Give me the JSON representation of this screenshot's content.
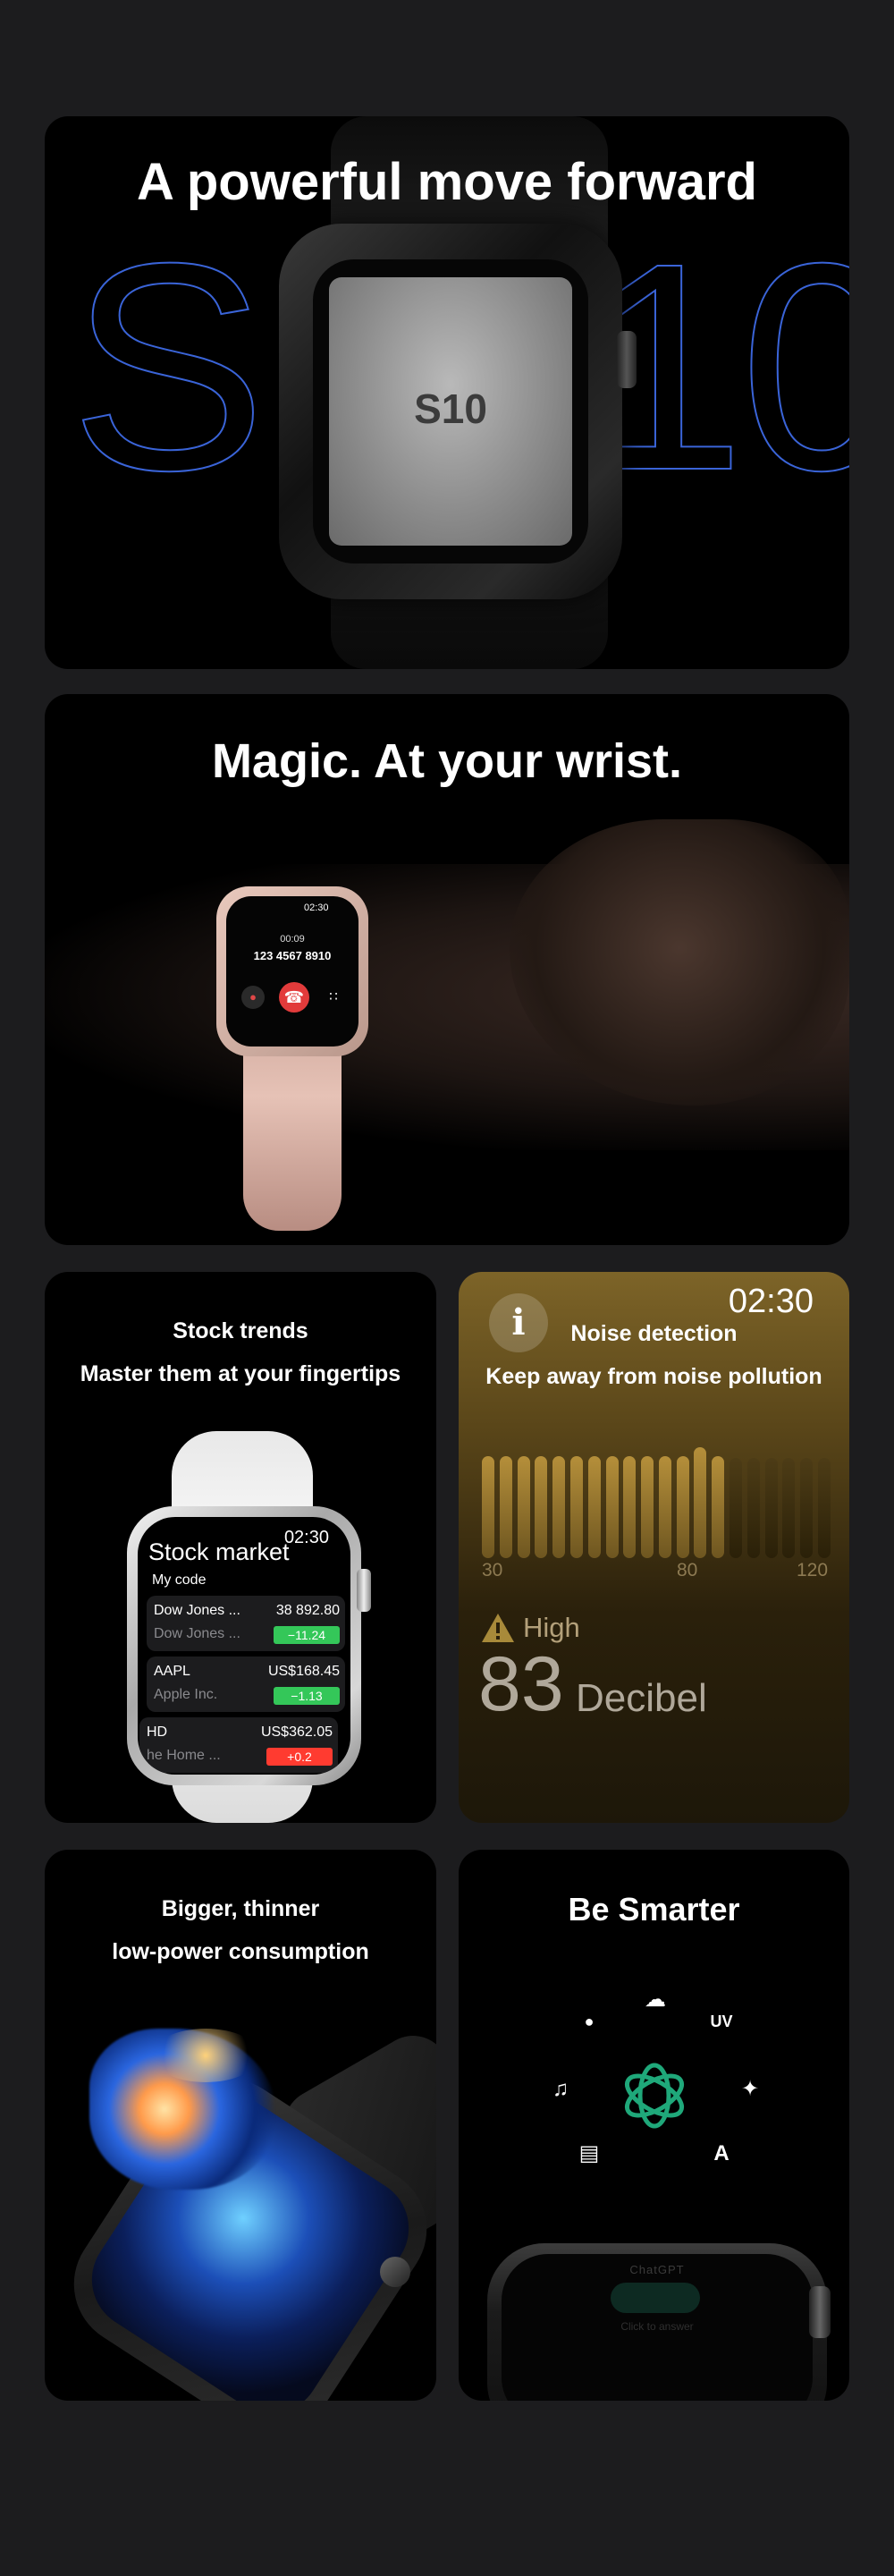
{
  "hero": {
    "title": "A powerful move forward",
    "outline_left": "S",
    "outline_right": "10",
    "chip_label": "S10"
  },
  "wrist": {
    "title": "Magic. At your wrist.",
    "call_time": "02:30",
    "call_duration": "00:09",
    "call_number": "123 4567 8910",
    "mute_icon": "mute-icon",
    "hangup_icon": "hangup-icon",
    "keypad_icon": "keypad-icon"
  },
  "stock": {
    "title": "Stock trends",
    "subtitle": "Master them at your fingertips",
    "watch_time": "02:30",
    "app_title": "Stock market",
    "section_label": "My code",
    "rows": [
      {
        "name": "Dow Jones ...",
        "sub": "Dow Jones ...",
        "price": "38 892.80",
        "change": "−11.24",
        "color": "#34c759"
      },
      {
        "name": "AAPL",
        "sub": "Apple Inc.",
        "price": "US$168.45",
        "change": "−1.13",
        "color": "#34c759"
      },
      {
        "name": "HD",
        "sub": "he Home ...",
        "price": "US$362.05",
        "change": "+0.2",
        "color": "#ff3b30"
      }
    ]
  },
  "noise": {
    "title": "Noise detection",
    "subtitle": "Keep away from noise pollution",
    "time": "02:30",
    "info_icon": "i",
    "axis_labels": [
      "30",
      "80",
      "120"
    ],
    "bar_levels": [
      0.88,
      0.88,
      0.88,
      0.88,
      0.88,
      0.88,
      0.88,
      0.88,
      0.88,
      0.88,
      0.88,
      0.88,
      0.95,
      0.88,
      0.86,
      0.86,
      0.86,
      0.86,
      0.86,
      0.86
    ],
    "active_bars": 14,
    "level_label": "High",
    "level_value": "83",
    "level_unit": "Decibel",
    "accent": "#b58f3a"
  },
  "display": {
    "title": "Bigger, thinner",
    "subtitle": "low-power consumption"
  },
  "smart": {
    "title": "Be Smarter",
    "icons": {
      "cloud": "☁",
      "chat": "●",
      "uv": "UV",
      "music": "♫",
      "game": "✦",
      "book": "▤",
      "appstore": "A"
    },
    "watch_app_name": "ChatGPT",
    "watch_app_hint": "Click to answer"
  }
}
